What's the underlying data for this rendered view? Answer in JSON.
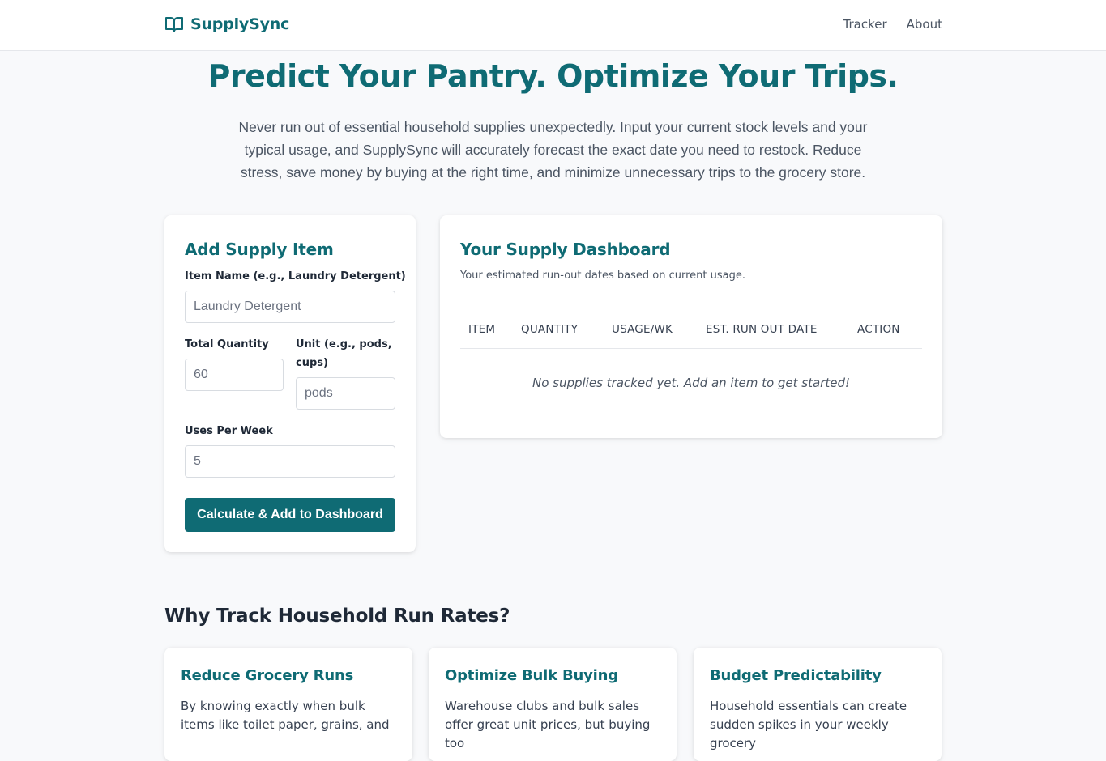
{
  "nav": {
    "brand": "SupplySync",
    "logo_icon": "open-book-icon",
    "links": [
      "Tracker",
      "About"
    ]
  },
  "hero": {
    "title": "Predict Your Pantry. Optimize Your Trips.",
    "subtitle": "Never run out of essential household supplies unexpectedly. Input your current stock levels and your typical usage, and SupplySync will accurately forecast the exact date you need to restock. Reduce stress, save money by buying at the right time, and minimize unnecessary trips to the grocery store."
  },
  "add_form": {
    "title": "Add Supply Item",
    "item_name_label": "Item Name (e.g., Laundry Detergent)",
    "item_name_placeholder": "Laundry Detergent",
    "quantity_label": "Total Quantity",
    "quantity_placeholder": "60",
    "unit_label": "Unit (e.g., pods, cups)",
    "unit_placeholder": "pods",
    "uses_label": "Uses Per Week",
    "uses_placeholder": "5",
    "submit_label": "Calculate & Add to Dashboard"
  },
  "dashboard": {
    "title": "Your Supply Dashboard",
    "subtitle": "Your estimated run-out dates based on current usage.",
    "columns": [
      "ITEM",
      "QUANTITY",
      "USAGE/WK",
      "EST. RUN OUT DATE",
      "ACTION"
    ],
    "empty_message": "No supplies tracked yet. Add an item to get started!"
  },
  "why": {
    "title": "Why Track Household Run Rates?",
    "features": [
      {
        "title": "Reduce Grocery Runs",
        "text": "By knowing exactly when bulk items like toilet paper, grains, and"
      },
      {
        "title": "Optimize Bulk Buying",
        "text": "Warehouse clubs and bulk sales offer great unit prices, but buying too"
      },
      {
        "title": "Budget Predictability",
        "text": "Household essentials can create sudden spikes in your weekly grocery"
      }
    ]
  },
  "colors": {
    "brand": "#0f6b74",
    "background": "#f8f9fb"
  }
}
